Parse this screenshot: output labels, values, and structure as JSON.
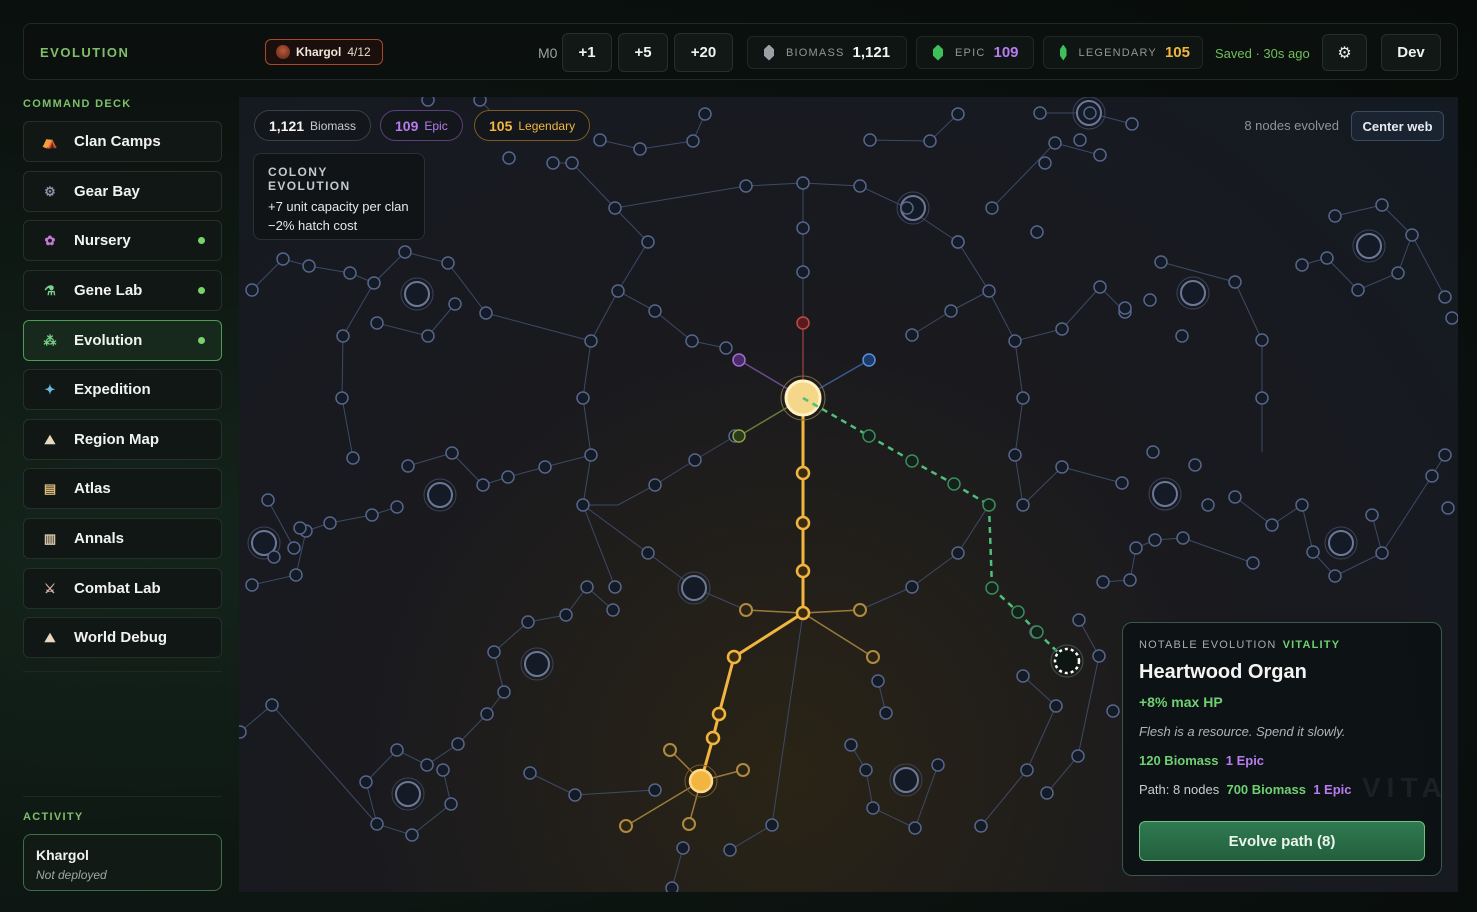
{
  "topbar": {
    "brand": "EVOLUTION",
    "clan_name": "Khargol",
    "clan_count": "4/12",
    "mo_label": "M0",
    "step_buttons": [
      "+1",
      "+5",
      "+20"
    ],
    "resources": [
      {
        "label": "BIOMASS",
        "value": "1,121",
        "color": "#f4f5f3",
        "gem": "#9aa0a4"
      },
      {
        "label": "EPIC",
        "value": "109",
        "color": "#b77cf0",
        "gem": "#3fbf5a"
      },
      {
        "label": "LEGENDARY",
        "value": "105",
        "color": "#f2b640",
        "gem": "#3fbf5a"
      }
    ],
    "saved_text": "Saved · 30s ago",
    "settings_icon": "gear-icon",
    "dev_label": "Dev"
  },
  "sidebar": {
    "heading": "COMMAND DECK",
    "items": [
      {
        "label": "Clan Camps",
        "icon": "camp-icon",
        "glyph": "⛺",
        "dot": false,
        "active": false
      },
      {
        "label": "Gear Bay",
        "icon": "gear-bay-icon",
        "glyph": "⚙",
        "dot": false,
        "active": false
      },
      {
        "label": "Nursery",
        "icon": "nursery-icon",
        "glyph": "✿",
        "dot": true,
        "active": false
      },
      {
        "label": "Gene Lab",
        "icon": "gene-lab-icon",
        "glyph": "⚗",
        "dot": true,
        "active": false
      },
      {
        "label": "Evolution",
        "icon": "evolution-icon",
        "glyph": "⁂",
        "dot": true,
        "active": true
      },
      {
        "label": "Expedition",
        "icon": "expedition-icon",
        "glyph": "✦",
        "dot": false,
        "active": false
      },
      {
        "label": "Region Map",
        "icon": "region-map-icon",
        "glyph": "⛰",
        "dot": false,
        "active": false
      },
      {
        "label": "Atlas",
        "icon": "atlas-icon",
        "glyph": "▤",
        "dot": false,
        "active": false
      },
      {
        "label": "Annals",
        "icon": "annals-icon",
        "glyph": "▥",
        "dot": false,
        "active": false
      },
      {
        "label": "Combat Lab",
        "icon": "combat-lab-icon",
        "glyph": "⚔",
        "dot": false,
        "active": false
      },
      {
        "label": "World Debug",
        "icon": "world-debug-icon",
        "glyph": "⛰",
        "dot": false,
        "active": false
      }
    ]
  },
  "activity": {
    "heading": "ACTIVITY",
    "name": "Khargol",
    "status": "Not deployed"
  },
  "web": {
    "pills": [
      {
        "value": "1,121",
        "label": "Biomass",
        "color": "#f4f5f3",
        "border": "#3a3f44"
      },
      {
        "value": "109",
        "label": "Epic",
        "color": "#b77cf0",
        "border": "#5a3f7a"
      },
      {
        "value": "105",
        "label": "Legendary",
        "color": "#f2b640",
        "border": "#7a5a22"
      }
    ],
    "colony": {
      "heading": "COLONY EVOLUTION",
      "lines": [
        "+7 unit capacity per clan",
        "−2% hatch cost"
      ]
    },
    "evolved_text": "8 nodes evolved",
    "center_label": "Center web"
  },
  "detail": {
    "kind": "NOTABLE EVOLUTION",
    "category": "VITALITY",
    "title": "Heartwood Organ",
    "effect": "+8% max HP",
    "flavor": "Flesh is a resource. Spend it slowly.",
    "cost_biomass": "120 Biomass",
    "cost_epic": "1 Epic",
    "path_label": "Path: 8 nodes",
    "path_biomass": "700 Biomass",
    "path_epic": "1 Epic",
    "evolve_label": "Evolve path (8)",
    "watermark": "VITA"
  }
}
